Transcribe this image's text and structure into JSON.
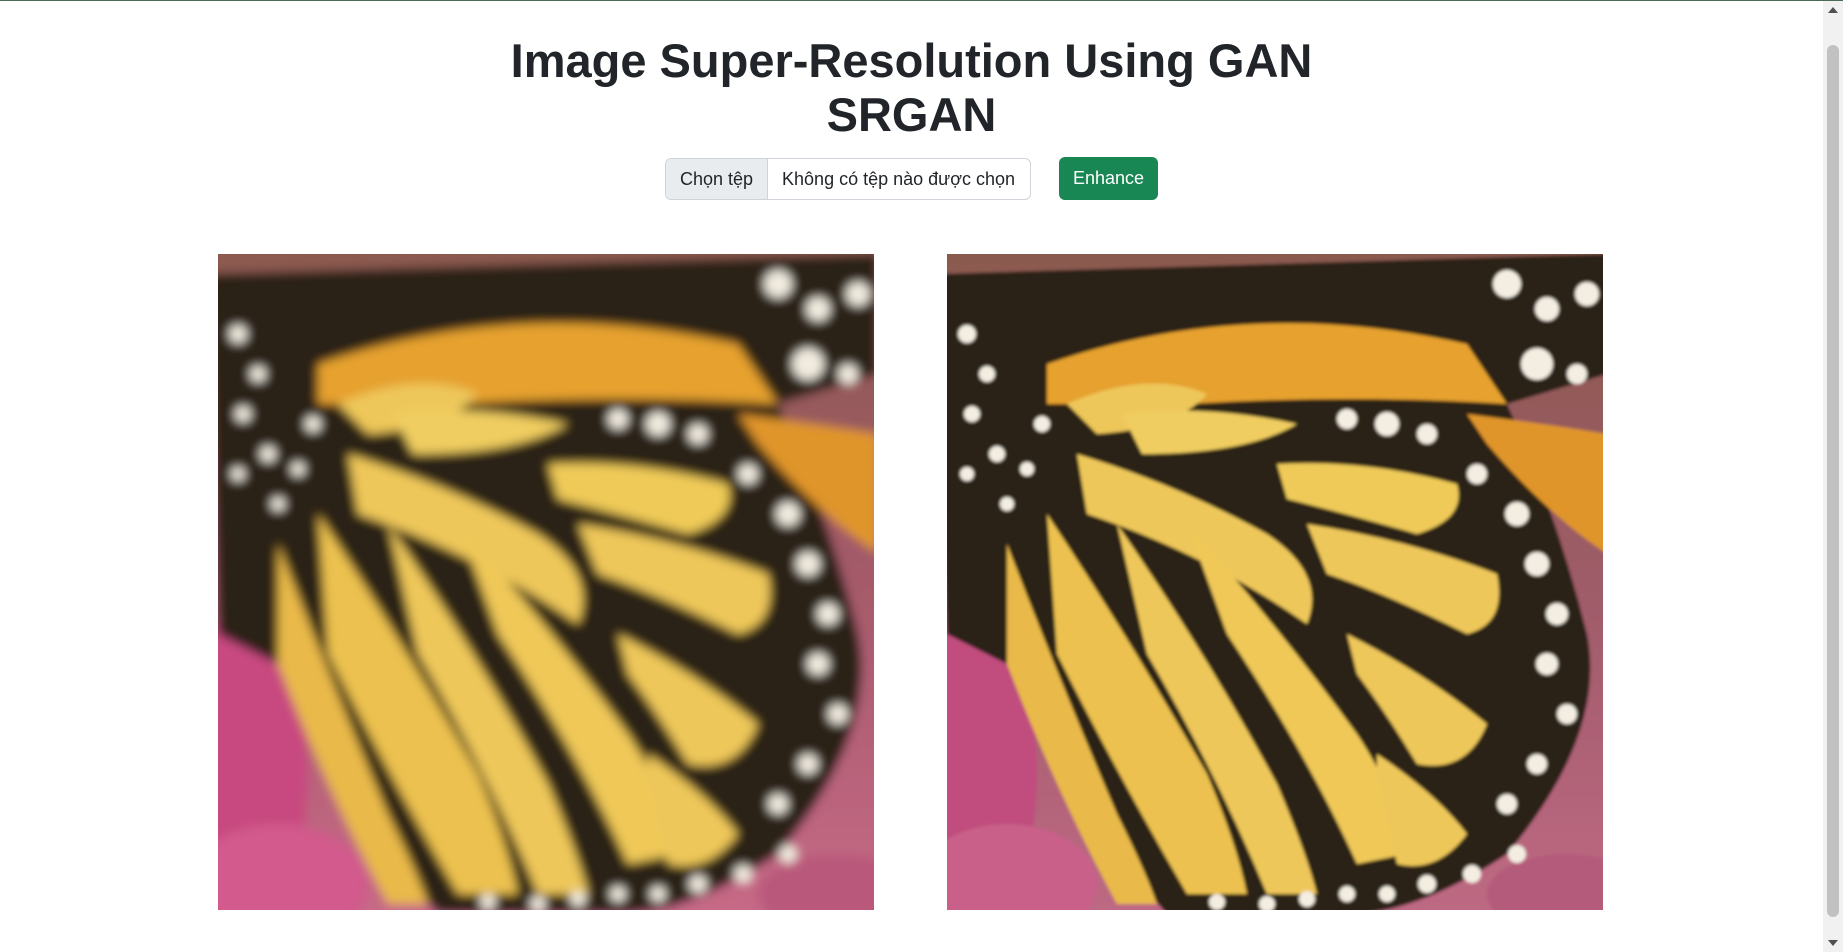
{
  "header": {
    "title_line1": "Image Super-Resolution Using GAN",
    "title_line2": "SRGAN"
  },
  "upload": {
    "choose_button": "Chọn tệp",
    "no_file_label": "Không có tệp nào được chọn",
    "enhance_button": "Enhance"
  },
  "images": {
    "low_res": "low-resolution butterfly wing image",
    "super_res": "super-resolved butterfly wing image"
  },
  "colors": {
    "accent": "#198754",
    "wing_orange": "#e6a12e",
    "wing_yellow": "#eec75a",
    "vein_black": "#2a2118",
    "flower_pink": "#c8497f"
  }
}
